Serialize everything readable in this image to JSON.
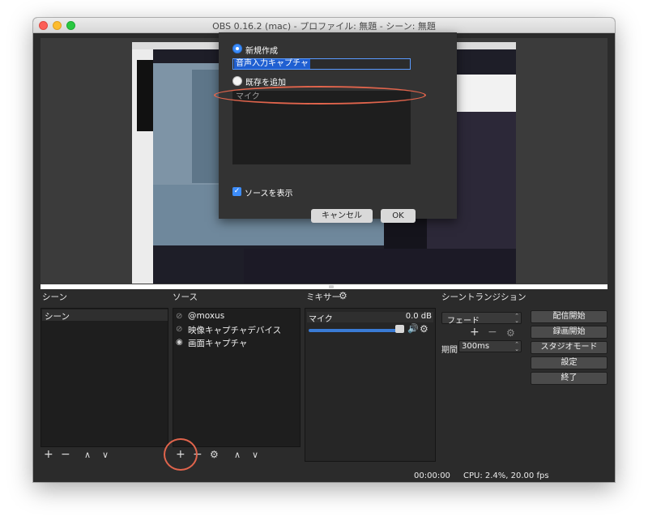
{
  "window": {
    "title": "OBS 0.16.2 (mac) - プロファイル: 無題 - シーン: 無題"
  },
  "dialog": {
    "create_new_label": "新規作成",
    "name_value": "音声入力キャプチャ",
    "add_existing_label": "既存を追加",
    "existing_items": [
      "マイク"
    ],
    "show_source_label": "ソースを表示",
    "cancel_label": "キャンセル",
    "ok_label": "OK"
  },
  "scenes": {
    "title": "シーン",
    "items": [
      "シーン"
    ]
  },
  "sources": {
    "title": "ソース",
    "items": [
      {
        "label": "@moxus",
        "visible": false
      },
      {
        "label": "映像キャプチャデバイス",
        "visible": false
      },
      {
        "label": "画面キャプチャ",
        "visible": true
      }
    ]
  },
  "mixer": {
    "title": "ミキサー",
    "channel_name": "マイク",
    "db_value": "0.0 dB",
    "volume_fraction": 1.0
  },
  "transitions": {
    "title": "シーントランジション",
    "selected": "フェード",
    "duration_label": "期間",
    "duration_value": "300ms"
  },
  "controls": {
    "start_streaming": "配信開始",
    "start_recording": "録画開始",
    "studio_mode": "スタジオモード",
    "settings": "設定",
    "exit": "終了"
  },
  "status": {
    "time": "00:00:00",
    "cpu": "CPU: 2.4%, 20.00 fps"
  },
  "colors": {
    "accent": "#3d8dfb",
    "annotation": "#e0644c"
  }
}
